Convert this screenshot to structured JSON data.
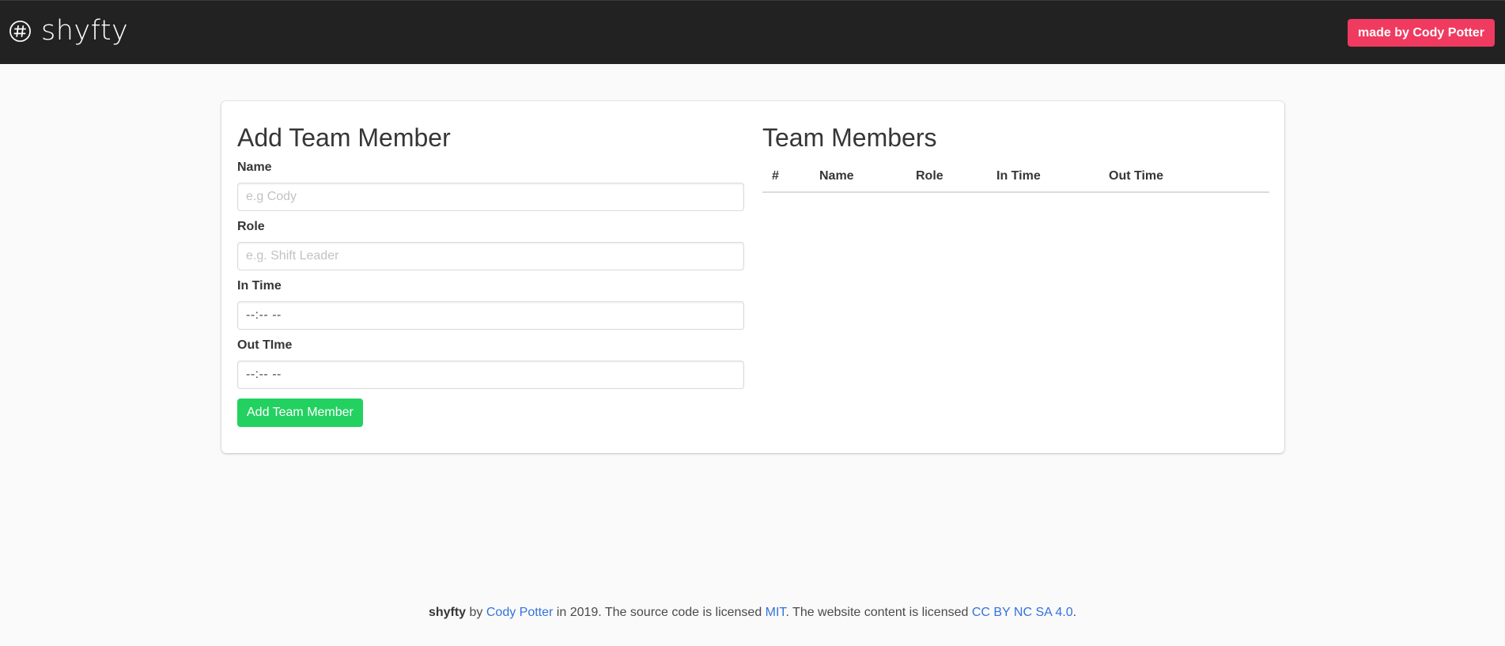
{
  "navbar": {
    "brand": "shyfty",
    "made_by_label": "made by Cody Potter",
    "accent_color": "#f03a5f"
  },
  "form": {
    "title": "Add Team Member",
    "name_label": "Name",
    "name_placeholder": "e.g Cody",
    "role_label": "Role",
    "role_placeholder": "e.g. Shift Leader",
    "in_time_label": "In Time",
    "in_time_value": "--:-- --",
    "out_time_label": "Out TIme",
    "out_time_value": "--:-- --",
    "submit_label": "Add Team Member",
    "submit_color": "#23d160"
  },
  "team": {
    "title": "Team Members",
    "columns": [
      "#",
      "Name",
      "Role",
      "In Time",
      "Out Time"
    ],
    "rows": []
  },
  "footer": {
    "brand": "shyfty",
    "by": " by ",
    "author": "Cody Potter",
    "text1": " in 2019. The source code is licensed ",
    "code_license": "MIT",
    "text2": ". The website content is licensed ",
    "content_license": "CC BY NC SA 4.0",
    "end": ".",
    "link_color": "#3273dc"
  }
}
